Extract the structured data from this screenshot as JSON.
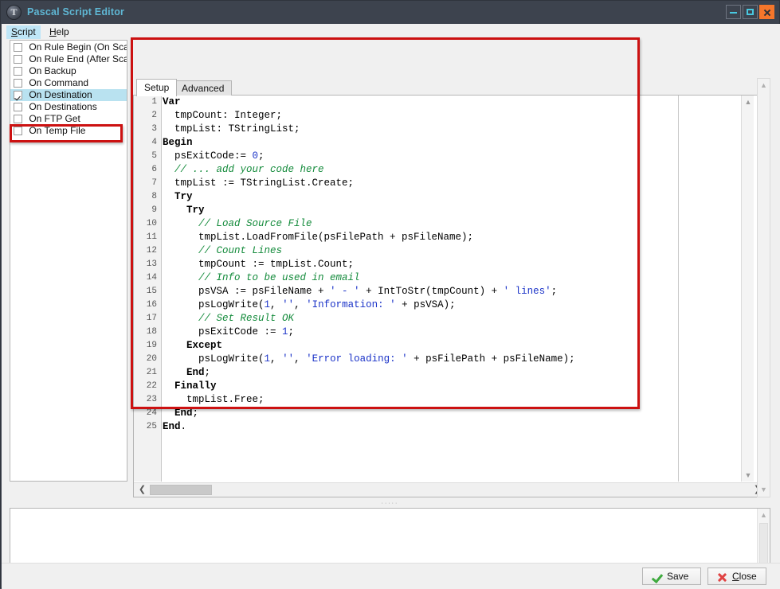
{
  "window": {
    "title": "Pascal Script Editor",
    "icon": "app-sphere-icon",
    "minimize_label": "–",
    "maximize_label": "□",
    "close_label": "✕"
  },
  "menu": {
    "items": [
      {
        "label": "Script",
        "accel": "S",
        "active": true
      },
      {
        "label": "Help",
        "accel": "H",
        "active": false
      }
    ]
  },
  "event_list": {
    "items": [
      {
        "label": "On Rule Begin (On Scan)",
        "checked": false,
        "selected": false
      },
      {
        "label": "On Rule End (After Scan)",
        "checked": false,
        "selected": false
      },
      {
        "label": "On Backup",
        "checked": false,
        "selected": false
      },
      {
        "label": "On Command",
        "checked": false,
        "selected": false
      },
      {
        "label": "On Destination",
        "checked": true,
        "selected": true
      },
      {
        "label": "On Destinations",
        "checked": false,
        "selected": false
      },
      {
        "label": "On FTP Get",
        "checked": false,
        "selected": false
      },
      {
        "label": "On Temp File",
        "checked": false,
        "selected": false
      }
    ]
  },
  "tabs": [
    {
      "label": "Setup",
      "active": true
    },
    {
      "label": "Advanced",
      "active": false
    }
  ],
  "editor": {
    "line_numbers": [
      "1",
      "2",
      "3",
      "4",
      "5",
      "6",
      "7",
      "8",
      "9",
      "10",
      "11",
      "12",
      "13",
      "14",
      "15",
      "16",
      "17",
      "18",
      "19",
      "20",
      "21",
      "22",
      "23",
      "24",
      "25"
    ],
    "lines": [
      {
        "n": 1,
        "text": "Var"
      },
      {
        "n": 2,
        "text": "  tmpCount: Integer;"
      },
      {
        "n": 3,
        "text": "  tmpList: TStringList;"
      },
      {
        "n": 4,
        "text": "Begin"
      },
      {
        "n": 5,
        "text": "  psExitCode:= 0;"
      },
      {
        "n": 6,
        "text": "  // ... add your code here"
      },
      {
        "n": 7,
        "text": "  tmpList := TStringList.Create;"
      },
      {
        "n": 8,
        "text": "  Try"
      },
      {
        "n": 9,
        "text": "    Try"
      },
      {
        "n": 10,
        "text": "      // Load Source File"
      },
      {
        "n": 11,
        "text": "      tmpList.LoadFromFile(psFilePath + psFileName);"
      },
      {
        "n": 12,
        "text": "      // Count Lines"
      },
      {
        "n": 13,
        "text": "      tmpCount := tmpList.Count;"
      },
      {
        "n": 14,
        "text": "      // Info to be used in email"
      },
      {
        "n": 15,
        "text": "      psVSA := psFileName + ' - ' + IntToStr(tmpCount) + ' lines';"
      },
      {
        "n": 16,
        "text": "      psLogWrite(1, '', 'Information: ' + psVSA);"
      },
      {
        "n": 17,
        "text": "      // Set Result OK"
      },
      {
        "n": 18,
        "text": "      psExitCode := 1;"
      },
      {
        "n": 19,
        "text": "    Except"
      },
      {
        "n": 20,
        "text": "      psLogWrite(1, '', 'Error loading: ' + psFilePath + psFileName);"
      },
      {
        "n": 21,
        "text": "    End;"
      },
      {
        "n": 22,
        "text": "  Finally"
      },
      {
        "n": 23,
        "text": "    tmpList.Free;"
      },
      {
        "n": 24,
        "text": "  End;"
      },
      {
        "n": 25,
        "text": "End."
      }
    ],
    "scroll_up_glyph": "▲",
    "scroll_down_glyph": "▼",
    "scroll_left_glyph": "❮",
    "scroll_right_glyph": "❯"
  },
  "output_panel": {
    "text": "",
    "scroll_up_glyph": "▲",
    "scroll_down_glyph": "▼"
  },
  "splitter": {
    "grip": "·····"
  },
  "footer": {
    "save_label": "Save",
    "save_icon": "green-check-icon",
    "close_label": "Close",
    "close_accel": "C",
    "close_icon": "red-x-icon"
  },
  "annotations": [
    {
      "name": "redbox-destination",
      "color": "#cc1111"
    },
    {
      "name": "redbox-code-area",
      "color": "#cc1111"
    }
  ],
  "colors": {
    "titlebar_bg": "#3d434e",
    "title_text": "#5fb7d4",
    "close_btn": "#f5762b",
    "selection": "#b9e2f0",
    "annotation": "#cc1111",
    "keyword": "#000000",
    "comment": "#128a3a",
    "string": "#1b33c8"
  }
}
